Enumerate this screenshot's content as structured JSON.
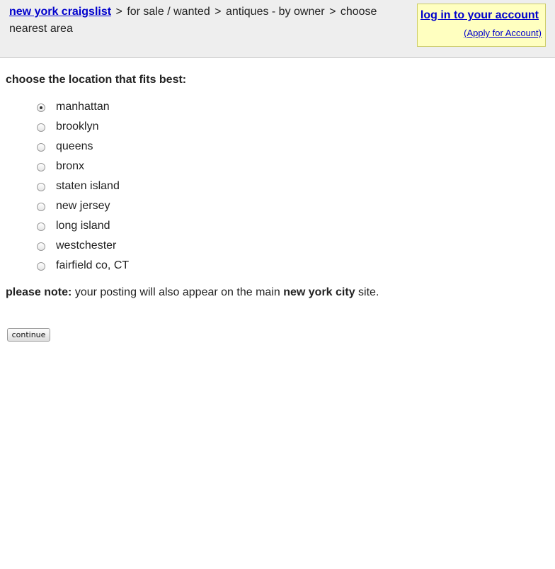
{
  "header": {
    "breadcrumb": {
      "home_link": "new york craigslist",
      "separator": ">",
      "crumb_1": "for sale / wanted",
      "crumb_2": "antiques - by owner",
      "crumb_3": "choose nearest area"
    },
    "login": {
      "login_link": "log in to your account",
      "apply_link": "(Apply for Account)"
    }
  },
  "form": {
    "prompt": "choose the location that fits best:",
    "options": [
      {
        "label": "manhattan",
        "checked": true
      },
      {
        "label": "brooklyn",
        "checked": false
      },
      {
        "label": "queens",
        "checked": false
      },
      {
        "label": "bronx",
        "checked": false
      },
      {
        "label": "staten island",
        "checked": false
      },
      {
        "label": "new jersey",
        "checked": false
      },
      {
        "label": "long island",
        "checked": false
      },
      {
        "label": "westchester",
        "checked": false
      },
      {
        "label": "fairfield co, CT",
        "checked": false
      }
    ],
    "note": {
      "lead": "please note:",
      "text_before": "your posting will also appear on the main",
      "site_name": "new york city",
      "text_after": "site."
    },
    "continue_label": "continue"
  },
  "colors": {
    "link": "#0000cc",
    "header_bg": "#eeeeee",
    "login_box_bg": "#ffffc0"
  }
}
